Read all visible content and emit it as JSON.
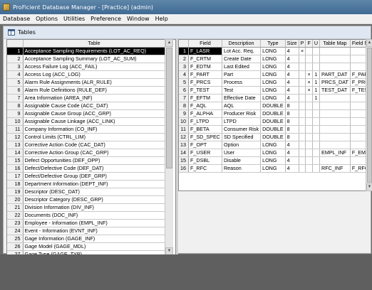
{
  "window": {
    "title": "ProFicient Database Manager - [Practice] (admin)"
  },
  "menu": [
    "Database",
    "Options",
    "Utilities",
    "Preference",
    "Window",
    "Help"
  ],
  "tables_window": {
    "title": "Tables"
  },
  "left_grid": {
    "header": "Table",
    "selected_row": 1,
    "rows": [
      "Acceptance Sampling Requirements (LOT_AC_REQ)",
      "Acceptance Sampling Summary (LOT_AC_SUM)",
      "Access Failure Log (ACC_FAIL)",
      "Access Log (ACC_LOG)",
      "Alarm Rule Assignments (ALR_RULE)",
      "Alarm Rule Definitions (RULE_DEF)",
      "Area Information (AREA_INF)",
      "Assignable Cause Code (ACC_DAT)",
      "Assignable Cause Group (ACC_GRP)",
      "Assignable Cause Linkage (ACC_LINK)",
      "Company Information (CO_INF)",
      "Control Limits (CTRL_LIM)",
      "Corrective Action Code (CAC_DAT)",
      "Corrective Action Group (CAC_GRP)",
      "Defect Opportunities (DEF_OPP)",
      "Defect/Defective Code (DEF_DAT)",
      "Defect/Defective Group (DEF_GRP)",
      "Department Information (DEPT_INF)",
      "Descriptor (DESC_DAT)",
      "Descriptor Category (DESC_GRP)",
      "Division Information (DIV_INF)",
      "Documents (DOC_INF)",
      "Employee - Information (EMPL_INF)",
      "Event - Information (EVNT_INF)",
      "Gage Information (GAGE_INF)",
      "Gage Model (GAGE_MDL)",
      "Gage Type (GAGE_TYP)",
      "Job (JOB_DAT)"
    ]
  },
  "right_grid": {
    "headers": [
      "Field",
      "Description",
      "Type",
      "Size",
      "P",
      "F",
      "U",
      "Table Map",
      "Field Map"
    ],
    "selected_row": 1,
    "rows": [
      [
        "F_LASR",
        "Lot Acc. Req.",
        "LONG",
        "4",
        "×",
        "",
        "",
        "",
        ""
      ],
      [
        "F_CRTM",
        "Create Date",
        "LONG",
        "4",
        "",
        "",
        "",
        "",
        ""
      ],
      [
        "F_EDTM",
        "Last Edited",
        "LONG",
        "4",
        "",
        "",
        "",
        "",
        ""
      ],
      [
        "F_PART",
        "Part",
        "LONG",
        "4",
        "",
        "×",
        "1",
        "PART_DAT",
        "F_PART"
      ],
      [
        "F_PRCS",
        "Process",
        "LONG",
        "4",
        "",
        "×",
        "1",
        "PRCS_DAT",
        "F_PRCS"
      ],
      [
        "F_TEST",
        "Test",
        "LONG",
        "4",
        "",
        "×",
        "1",
        "TEST_DAT",
        "F_TEST"
      ],
      [
        "F_EFTM",
        "Effective Date",
        "LONG",
        "4",
        "",
        "",
        "1",
        "",
        ""
      ],
      [
        "F_AQL",
        "AQL",
        "DOUBLE",
        "8",
        "",
        "",
        "",
        "",
        ""
      ],
      [
        "F_ALPHA",
        "Producer Risk",
        "DOUBLE",
        "8",
        "",
        "",
        "",
        "",
        ""
      ],
      [
        "F_LTPD",
        "LTPD",
        "DOUBLE",
        "8",
        "",
        "",
        "",
        "",
        ""
      ],
      [
        "F_BETA",
        "Consumer Risk",
        "DOUBLE",
        "8",
        "",
        "",
        "",
        "",
        ""
      ],
      [
        "F_SD_SPEC",
        "SD Specified",
        "DOUBLE",
        "8",
        "",
        "",
        "",
        "",
        ""
      ],
      [
        "F_OPT",
        "Option",
        "LONG",
        "4",
        "",
        "",
        "",
        "",
        ""
      ],
      [
        "F_USER",
        "User",
        "LONG",
        "4",
        "",
        "",
        "",
        "EMPL_INF",
        "F_EMPL"
      ],
      [
        "F_DSBL",
        "Disable",
        "LONG",
        "4",
        "",
        "",
        "",
        "",
        ""
      ],
      [
        "F_RFC",
        "Reason",
        "LONG",
        "4",
        "",
        "",
        "",
        "RFC_INF",
        "F_RFC"
      ]
    ]
  }
}
